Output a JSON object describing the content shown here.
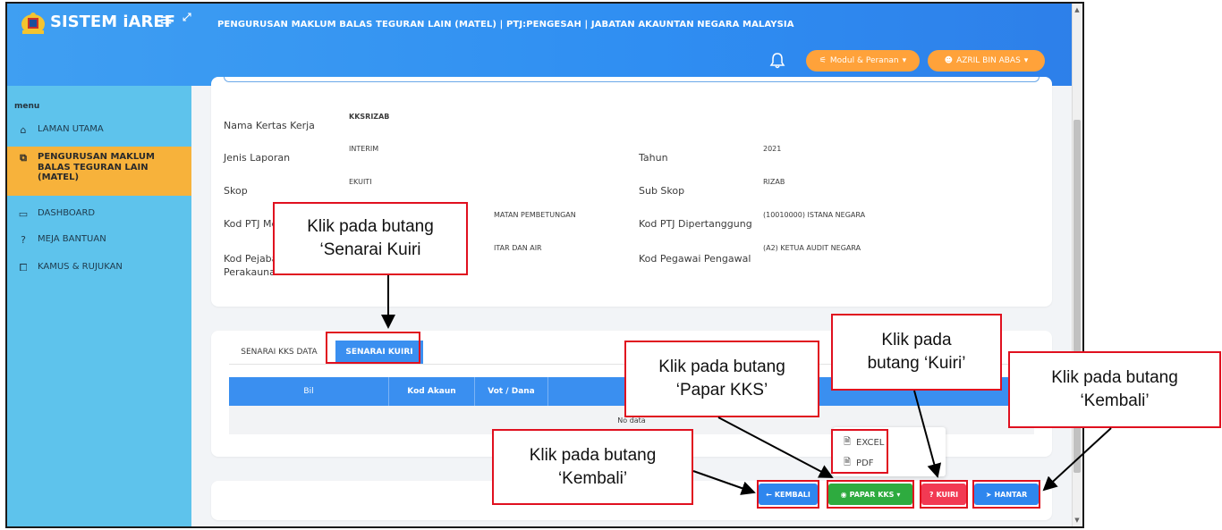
{
  "header": {
    "brand": "SISTEM iAREF",
    "menu_toggle": "≡",
    "expand": "⤢",
    "page_heading": "PENGURUSAN MAKLUM BALAS TEGURAN LAIN (MATEL) | PTJ:PENGESAH | JABATAN AKAUNTAN NEGARA MALAYSIA",
    "modul_label": "Modul & Peranan",
    "user_label": "AZRIL BIN ABAS"
  },
  "sidebar": {
    "title": "menu",
    "items": [
      {
        "label": "LAMAN UTAMA",
        "icon": "home-icon"
      },
      {
        "label": "PENGURUSAN MAKLUM BALAS TEGURAN LAIN (MATEL)",
        "icon": "clipboard-icon",
        "active": true
      },
      {
        "label": "DASHBOARD",
        "icon": "dashboard-icon"
      },
      {
        "label": "MEJA BANTUAN",
        "icon": "question-icon"
      },
      {
        "label": "KAMUS & RUJUKAN",
        "icon": "book-icon"
      }
    ]
  },
  "info": {
    "nama_label": "Nama Kertas Kerja",
    "nama_value": "KKSRIZAB",
    "jenis_label": "Jenis Laporan",
    "jenis_value": "INTERIM",
    "tahun_label": "Tahun",
    "tahun_value": "2021",
    "skop_label": "Skop",
    "skop_value": "EKUITI",
    "subskop_label": "Sub Skop",
    "subskop_value": "RIZAB",
    "kodptj_label": "Kod PTJ Me",
    "kodptj_value": "MATAN PEMBETUNGAN",
    "kodptjd_label": "Kod PTJ Dipertanggung",
    "kodptjd_value": "(10010000) ISTANA NEGARA",
    "kodpej_label": "Kod Pejaba",
    "kodpej_label2": "Perakaunan",
    "kodpej_value": "ITAR DAN AIR",
    "kodpeg_label": "Kod Pegawai Pengawal",
    "kodpeg_value": "(A2) KETUA AUDIT NEGARA"
  },
  "tabs": [
    {
      "label": "SENARAI KKS DATA"
    },
    {
      "label": "SENARAI KUIRI",
      "active": true
    }
  ],
  "table": {
    "columns": [
      "Bil",
      "Kod Akaun",
      "Vot / Dana"
    ],
    "empty_text": "No data"
  },
  "dropdown": {
    "items": [
      "EXCEL",
      "PDF"
    ]
  },
  "buttons": {
    "kembali": "KEMBALI",
    "papar": "PAPAR KKS",
    "kuiri": "KUIRI",
    "hantar": "HANTAR"
  },
  "callouts": {
    "senarai_kuiri": [
      "Klik pada butang",
      "‘Senarai Kuiri"
    ],
    "papar_kks": [
      "Klik pada butang",
      "‘Papar KKS’"
    ],
    "kuiri": [
      "Klik pada",
      "butang ‘Kuiri’"
    ],
    "kembali_right": [
      "Klik pada butang",
      "‘Kembali’"
    ],
    "kembali_bottom": [
      "Klik pada butang",
      "‘Kembali’"
    ]
  },
  "colors": {
    "header_blue": "#2f8ef2",
    "sidebar": "#5ec3ec",
    "active_item": "#f7b23b",
    "pill": "#ffa23a",
    "btn_blue": "#2e86ee",
    "btn_green": "#2eab3f",
    "btn_red": "#f23a53",
    "annotation_red": "#e0101f"
  }
}
